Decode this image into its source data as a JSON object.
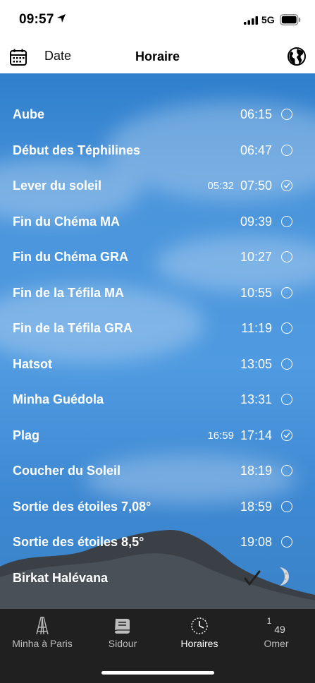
{
  "status": {
    "time": "09:57",
    "network": "5G"
  },
  "nav": {
    "date_label": "Date",
    "title": "Horaire"
  },
  "rows": [
    {
      "label": "Aube",
      "time": "06:15",
      "alt": "",
      "checked": false
    },
    {
      "label": "Début des Téphilines",
      "time": "06:47",
      "alt": "",
      "checked": false
    },
    {
      "label": "Lever du soleil",
      "time": "07:50",
      "alt": "05:32",
      "checked": true
    },
    {
      "label": "Fin du Chéma MA",
      "time": "09:39",
      "alt": "",
      "checked": false
    },
    {
      "label": "Fin du Chéma GRA",
      "time": "10:27",
      "alt": "",
      "checked": false
    },
    {
      "label": "Fin de la Téfila MA",
      "time": "10:55",
      "alt": "",
      "checked": false
    },
    {
      "label": "Fin de la Téfila GRA",
      "time": "11:19",
      "alt": "",
      "checked": false
    },
    {
      "label": "Hatsot",
      "time": "13:05",
      "alt": "",
      "checked": false
    },
    {
      "label": "Minha Guédola",
      "time": "13:31",
      "alt": "",
      "checked": false
    },
    {
      "label": "Plag",
      "time": "17:14",
      "alt": "16:59",
      "checked": true
    },
    {
      "label": "Coucher du Soleil",
      "time": "18:19",
      "alt": "",
      "checked": false
    },
    {
      "label": "Sortie des étoiles 7,08°",
      "time": "18:59",
      "alt": "",
      "checked": false
    },
    {
      "label": "Sortie des étoiles 8,5°",
      "time": "19:08",
      "alt": "",
      "checked": false
    }
  ],
  "birkat": {
    "label": "Birkat Halévana",
    "icons": [
      "checkmark-icon",
      "moon-icon"
    ]
  },
  "tabs": [
    {
      "label": "Minha à Paris",
      "icon": "eiffel-tower-icon",
      "active": false
    },
    {
      "label": "Sidour",
      "icon": "book-icon",
      "active": false
    },
    {
      "label": "Horaires",
      "icon": "clock-icon",
      "active": true
    },
    {
      "label": "Omer",
      "icon": "omer-count",
      "active": false
    }
  ],
  "omer": {
    "week": "1",
    "day": "49"
  },
  "colors": {
    "sky": "#4a95dc",
    "tab_bar": "#202020",
    "text": "#ffffff"
  }
}
